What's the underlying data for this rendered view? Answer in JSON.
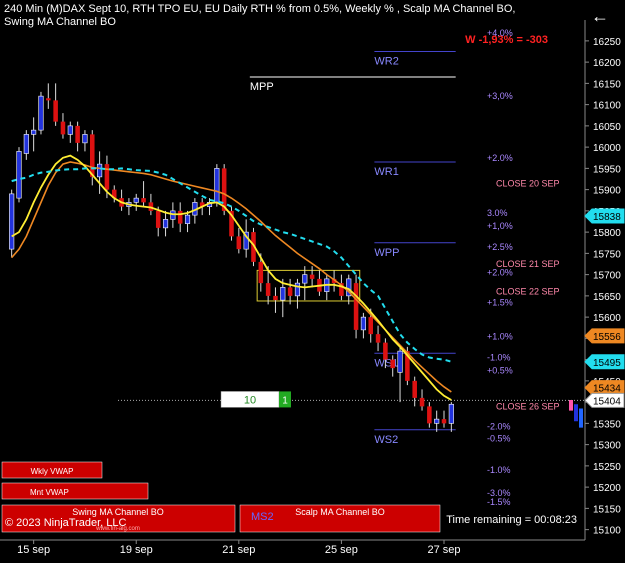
{
  "header": {
    "title": "240 Min (M)DAX Sept 10, RTH TPO EU, EU Daily RTH % from 0.5%, Weekly % , Scalp MA Channel BO, Swing MA Channel BO",
    "back_icon": "arrow-left-icon"
  },
  "status": {
    "weekly_change": "W -1,93% = -303"
  },
  "footer": {
    "copyright": "© 2023 NinjaTrader, LLC",
    "time_remaining": "Time remaining = 00:08:23",
    "box_wkly_vwap": "Wkly VWAP",
    "box_mnt_vwap": "Mnt VWAP",
    "box_swing": "Swing MA Channel BO",
    "box_scalp": "Scalp MA Channel BO",
    "box_ms2": "MS2",
    "website": "www.fin-alg.com"
  },
  "cursor_box": {
    "value": "10",
    "tag": "1"
  },
  "colors": {
    "background": "#000000",
    "bull": "#2233dd",
    "bear": "#dd1111",
    "ma_fast": "#ffee33",
    "ma_slow": "#ee8822",
    "scalp_channel": "#22ddee",
    "pivot_lines": "#4444cc",
    "pct_labels": "#aa88ff",
    "close_labels": "#ff88aa",
    "weekly_red": "#ff2222"
  },
  "chart_data": {
    "type": "candlestick",
    "instrument": "DAX",
    "timeframe": "240 Min",
    "ylim": [
      15085,
      16285
    ],
    "y_ticks": [
      15100,
      15150,
      15200,
      15250,
      15300,
      15350,
      15400,
      15450,
      15500,
      15550,
      15600,
      15650,
      15700,
      15750,
      15800,
      15850,
      15900,
      15950,
      16000,
      16050,
      16100,
      16150,
      16200,
      16250
    ],
    "x_ticks": [
      {
        "bar": 3,
        "label": "15 sep"
      },
      {
        "bar": 17,
        "label": "19 sep"
      },
      {
        "bar": 31,
        "label": "21 sep"
      },
      {
        "bar": 45,
        "label": "25 sep"
      },
      {
        "bar": 59,
        "label": "27 sep"
      }
    ],
    "bars": [
      {
        "o": 15760,
        "h": 15900,
        "l": 15740,
        "c": 15890
      },
      {
        "o": 15880,
        "h": 16000,
        "l": 15870,
        "c": 15990
      },
      {
        "o": 15985,
        "h": 16040,
        "l": 15970,
        "c": 16030
      },
      {
        "o": 16030,
        "h": 16070,
        "l": 15990,
        "c": 16040
      },
      {
        "o": 16040,
        "h": 16130,
        "l": 16030,
        "c": 16120
      },
      {
        "o": 16115,
        "h": 16150,
        "l": 16090,
        "c": 16110
      },
      {
        "o": 16110,
        "h": 16150,
        "l": 16050,
        "c": 16060
      },
      {
        "o": 16060,
        "h": 16080,
        "l": 16020,
        "c": 16030
      },
      {
        "o": 16030,
        "h": 16060,
        "l": 16010,
        "c": 16050
      },
      {
        "o": 16050,
        "h": 16060,
        "l": 15990,
        "c": 16010
      },
      {
        "o": 16010,
        "h": 16040,
        "l": 15990,
        "c": 16030
      },
      {
        "o": 16030,
        "h": 16040,
        "l": 15910,
        "c": 15930
      },
      {
        "o": 15930,
        "h": 15990,
        "l": 15890,
        "c": 15960
      },
      {
        "o": 15960,
        "h": 15980,
        "l": 15880,
        "c": 15900
      },
      {
        "o": 15900,
        "h": 15910,
        "l": 15870,
        "c": 15880
      },
      {
        "o": 15880,
        "h": 15900,
        "l": 15850,
        "c": 15860
      },
      {
        "o": 15860,
        "h": 15880,
        "l": 15840,
        "c": 15870
      },
      {
        "o": 15870,
        "h": 15890,
        "l": 15850,
        "c": 15880
      },
      {
        "o": 15880,
        "h": 15920,
        "l": 15860,
        "c": 15870
      },
      {
        "o": 15870,
        "h": 15890,
        "l": 15840,
        "c": 15850
      },
      {
        "o": 15850,
        "h": 15860,
        "l": 15790,
        "c": 15810
      },
      {
        "o": 15810,
        "h": 15850,
        "l": 15790,
        "c": 15830
      },
      {
        "o": 15830,
        "h": 15870,
        "l": 15810,
        "c": 15850
      },
      {
        "o": 15850,
        "h": 15870,
        "l": 15800,
        "c": 15820
      },
      {
        "o": 15820,
        "h": 15850,
        "l": 15800,
        "c": 15840
      },
      {
        "o": 15840,
        "h": 15880,
        "l": 15820,
        "c": 15870
      },
      {
        "o": 15870,
        "h": 15880,
        "l": 15840,
        "c": 15860
      },
      {
        "o": 15860,
        "h": 15880,
        "l": 15840,
        "c": 15870
      },
      {
        "o": 15870,
        "h": 15960,
        "l": 15860,
        "c": 15950
      },
      {
        "o": 15950,
        "h": 15960,
        "l": 15840,
        "c": 15850
      },
      {
        "o": 15850,
        "h": 15860,
        "l": 15780,
        "c": 15790
      },
      {
        "o": 15790,
        "h": 15810,
        "l": 15750,
        "c": 15760
      },
      {
        "o": 15760,
        "h": 15830,
        "l": 15740,
        "c": 15800
      },
      {
        "o": 15800,
        "h": 15810,
        "l": 15720,
        "c": 15730
      },
      {
        "o": 15730,
        "h": 15750,
        "l": 15660,
        "c": 15680
      },
      {
        "o": 15680,
        "h": 15720,
        "l": 15630,
        "c": 15650
      },
      {
        "o": 15650,
        "h": 15670,
        "l": 15610,
        "c": 15640
      },
      {
        "o": 15640,
        "h": 15690,
        "l": 15600,
        "c": 15670
      },
      {
        "o": 15670,
        "h": 15690,
        "l": 15630,
        "c": 15650
      },
      {
        "o": 15650,
        "h": 15690,
        "l": 15620,
        "c": 15680
      },
      {
        "o": 15680,
        "h": 15720,
        "l": 15640,
        "c": 15700
      },
      {
        "o": 15700,
        "h": 15720,
        "l": 15670,
        "c": 15690
      },
      {
        "o": 15690,
        "h": 15710,
        "l": 15650,
        "c": 15660
      },
      {
        "o": 15660,
        "h": 15700,
        "l": 15640,
        "c": 15690
      },
      {
        "o": 15690,
        "h": 15710,
        "l": 15660,
        "c": 15680
      },
      {
        "o": 15680,
        "h": 15700,
        "l": 15640,
        "c": 15650
      },
      {
        "o": 15650,
        "h": 15700,
        "l": 15630,
        "c": 15690
      },
      {
        "o": 15680,
        "h": 15700,
        "l": 15550,
        "c": 15570
      },
      {
        "o": 15570,
        "h": 15610,
        "l": 15550,
        "c": 15600
      },
      {
        "o": 15600,
        "h": 15620,
        "l": 15540,
        "c": 15560
      },
      {
        "o": 15560,
        "h": 15580,
        "l": 15520,
        "c": 15540
      },
      {
        "o": 15540,
        "h": 15550,
        "l": 15480,
        "c": 15500
      },
      {
        "o": 15500,
        "h": 15510,
        "l": 15460,
        "c": 15480
      },
      {
        "o": 15470,
        "h": 15530,
        "l": 15400,
        "c": 15520
      },
      {
        "o": 15520,
        "h": 15530,
        "l": 15440,
        "c": 15450
      },
      {
        "o": 15450,
        "h": 15460,
        "l": 15390,
        "c": 15410
      },
      {
        "o": 15410,
        "h": 15430,
        "l": 15380,
        "c": 15390
      },
      {
        "o": 15390,
        "h": 15400,
        "l": 15340,
        "c": 15350
      },
      {
        "o": 15350,
        "h": 15380,
        "l": 15330,
        "c": 15360
      },
      {
        "o": 15360,
        "h": 15380,
        "l": 15340,
        "c": 15350
      },
      {
        "o": 15350,
        "h": 15400,
        "l": 15330,
        "c": 15395
      }
    ],
    "ma_fast": [
      15790,
      15800,
      15830,
      15870,
      15905,
      15935,
      15960,
      15975,
      15980,
      15970,
      15955,
      15935,
      15915,
      15895,
      15880,
      15870,
      15865,
      15862,
      15860,
      15858,
      15852,
      15846,
      15842,
      15842,
      15845,
      15852,
      15860,
      15868,
      15870,
      15860,
      15840,
      15815,
      15790,
      15770,
      15740,
      15710,
      15690,
      15680,
      15676,
      15672,
      15670,
      15672,
      15674,
      15676,
      15676,
      15672,
      15666,
      15650,
      15632,
      15612,
      15592,
      15570,
      15548,
      15530,
      15510,
      15490,
      15470,
      15450,
      15430,
      15415,
      15405
    ],
    "ma_slow": [
      15740,
      15760,
      15790,
      15830,
      15870,
      15910,
      15940,
      15960,
      15965,
      15962,
      15958,
      15952,
      15950,
      15948,
      15946,
      15944,
      15942,
      15940,
      15938,
      15935,
      15930,
      15925,
      15920,
      15916,
      15912,
      15908,
      15904,
      15900,
      15896,
      15890,
      15880,
      15868,
      15855,
      15840,
      15825,
      15808,
      15792,
      15778,
      15764,
      15750,
      15738,
      15726,
      15714,
      15700,
      15688,
      15675,
      15660,
      15642,
      15624,
      15606,
      15588,
      15570,
      15552,
      15534,
      15516,
      15498,
      15482,
      15466,
      15450,
      15436,
      15424
    ],
    "channel": [
      15920,
      15925,
      15928,
      15935,
      15940,
      15942,
      15945,
      15947,
      15948,
      15948,
      15950,
      15950,
      15950,
      15948,
      15948,
      15950,
      15948,
      15946,
      15945,
      15944,
      15940,
      15935,
      15925,
      15915,
      15905,
      15895,
      15885,
      15876,
      15872,
      15868,
      15860,
      15850,
      15838,
      15826,
      15818,
      15812,
      15806,
      15800,
      15796,
      15790,
      15784,
      15778,
      15772,
      15766,
      15755,
      15740,
      15720,
      15700,
      15680,
      15664,
      15650,
      15620,
      15590,
      15560,
      15540,
      15525,
      15512,
      15505,
      15502,
      15500,
      15495
    ],
    "pivots": [
      {
        "label": "WR2",
        "y": 16225,
        "from": 50,
        "to": 60
      },
      {
        "label": "MPP",
        "y": 16165,
        "from": 33,
        "to": 60
      },
      {
        "label": "WR1",
        "y": 15965,
        "from": 50,
        "to": 60
      },
      {
        "label": "WPP",
        "y": 15775,
        "from": 50,
        "to": 60
      },
      {
        "label": "WS1",
        "y": 15515,
        "from": 50,
        "to": 60
      },
      {
        "label": "WS2",
        "y": 15335,
        "from": 50,
        "to": 60
      }
    ],
    "daily_pcts": [
      {
        "label": "+3,0%",
        "y": 16120
      },
      {
        "label": "+2.0%",
        "y": 15975
      },
      {
        "label": "3.0%",
        "y": 15845
      },
      {
        "label": "+1,0%",
        "y": 15815
      },
      {
        "label": "+2.5%",
        "y": 15765
      },
      {
        "label": "+2.0%",
        "y": 15705
      },
      {
        "label": "+1.5%",
        "y": 15635
      },
      {
        "label": "+1.0%",
        "y": 15555
      },
      {
        "label": "-1.0%",
        "y": 15505
      },
      {
        "label": "+0.5%",
        "y": 15475
      },
      {
        "label": "-2.0%",
        "y": 15343
      },
      {
        "label": "-0.5%",
        "y": 15315
      },
      {
        "label": "-1.0%",
        "y": 15240
      },
      {
        "label": "-3.0%",
        "y": 15186
      },
      {
        "label": "-1.5%",
        "y": 15165
      }
    ],
    "close_labels": [
      {
        "label": "CLOSE 20 SEP",
        "y": 15915
      },
      {
        "label": "CLOSE 21 SEP",
        "y": 15725
      },
      {
        "label": "CLOSE 22 SEP",
        "y": 15660
      },
      {
        "label": "CLOSE 26 SEP",
        "y": 15390
      }
    ],
    "price_markers": [
      {
        "value": "15838",
        "y": 15838,
        "color": "#22ddee"
      },
      {
        "value": "15556",
        "y": 15556,
        "color": "#ee8822"
      },
      {
        "value": "15495",
        "y": 15495,
        "color": "#22ddee"
      },
      {
        "value": "15434",
        "y": 15434,
        "color": "#ee8822"
      },
      {
        "value": "15404",
        "y": 15404,
        "color": "#ffffff"
      }
    ],
    "current_price": 15404,
    "consolidation_box": {
      "from": 34,
      "to": 47,
      "top": 15710,
      "bottom": 15638
    },
    "upper_percent_label": {
      "label": "+4.0%",
      "y": 16268
    }
  }
}
